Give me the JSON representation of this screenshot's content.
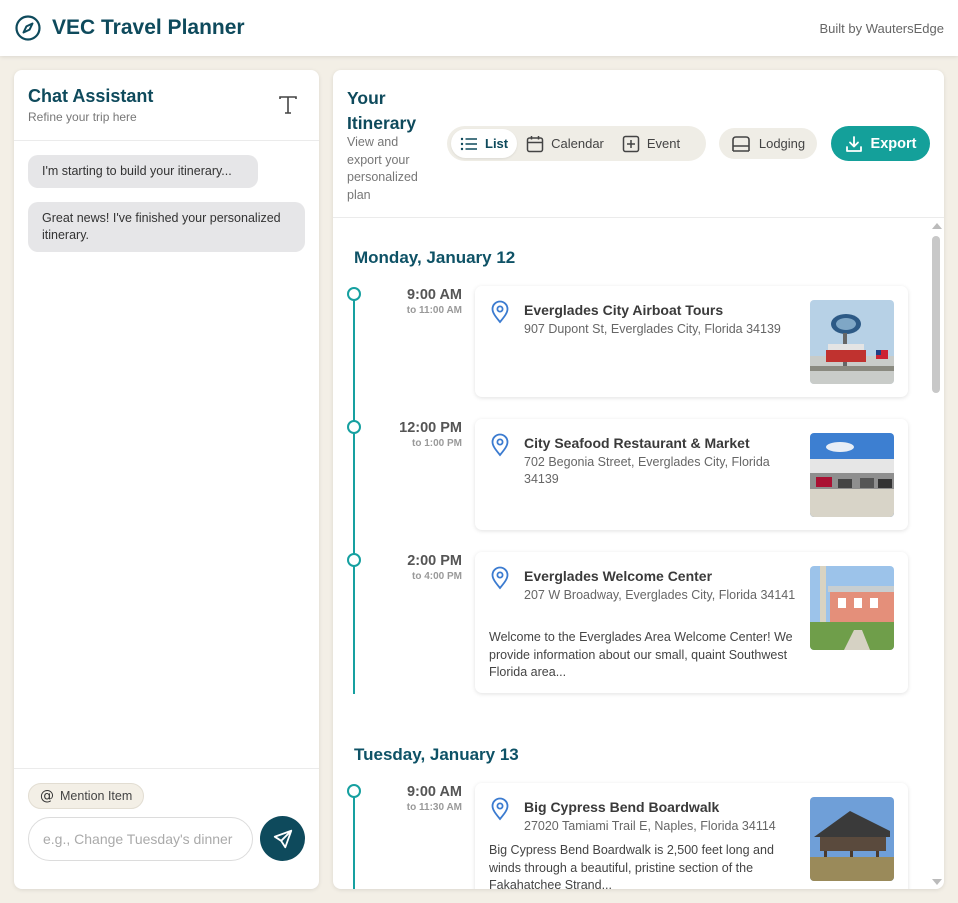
{
  "header": {
    "app_title": "VEC Travel Planner",
    "built_by": "Built by WautersEdge",
    "logo_icon": "compass-icon",
    "brand_color": "#0e4a5c"
  },
  "chat": {
    "title": "Chat Assistant",
    "subtitle": "Refine your trip here",
    "text_size_icon": "text-format-icon",
    "messages": [
      {
        "text": "I'm starting to build your itinerary..."
      },
      {
        "text": "Great news! I've finished your personalized itinerary."
      }
    ],
    "mention_label": "Mention Item",
    "input_placeholder": "e.g., Change Tuesday's dinner",
    "input_value": "",
    "send_icon": "send-icon"
  },
  "itinerary": {
    "title": "Your Itinerary",
    "subtitle": "View and export your personalized plan",
    "views": [
      {
        "label": "List",
        "icon": "list-icon",
        "active": true
      },
      {
        "label": "Calendar",
        "icon": "calendar-icon",
        "active": false
      },
      {
        "label": "Event",
        "icon": "add-event-icon",
        "active": false
      }
    ],
    "lodging_label": "Lodging",
    "export_label": "Export",
    "accent_color": "#14a09a",
    "days": [
      {
        "date": "Monday, January 12",
        "items": [
          {
            "start": "9:00 AM",
            "end": "to 11:00 AM",
            "name": "Everglades City Airboat Tours",
            "address": "907 Dupont St, Everglades City, Florida 34139",
            "description": ""
          },
          {
            "start": "12:00 PM",
            "end": "to 1:00 PM",
            "name": "City Seafood Restaurant & Market",
            "address": "702 Begonia Street, Everglades City, Florida 34139",
            "description": ""
          },
          {
            "start": "2:00 PM",
            "end": "to 4:00 PM",
            "name": "Everglades Welcome Center",
            "address": "207 W Broadway, Everglades City, Florida 34141",
            "description": "Welcome to the Everglades Area Welcome Center! We provide information about our small, quaint Southwest Florida area..."
          }
        ]
      },
      {
        "date": "Tuesday, January 13",
        "items": [
          {
            "start": "9:00 AM",
            "end": "to 11:30 AM",
            "name": "Big Cypress Bend Boardwalk",
            "address": "27020 Tamiami Trail E, Naples, Florida 34114",
            "description": "Big Cypress Bend Boardwalk is 2,500 feet long and winds through a beautiful, pristine section of the Fakahatchee Strand..."
          }
        ]
      }
    ]
  }
}
